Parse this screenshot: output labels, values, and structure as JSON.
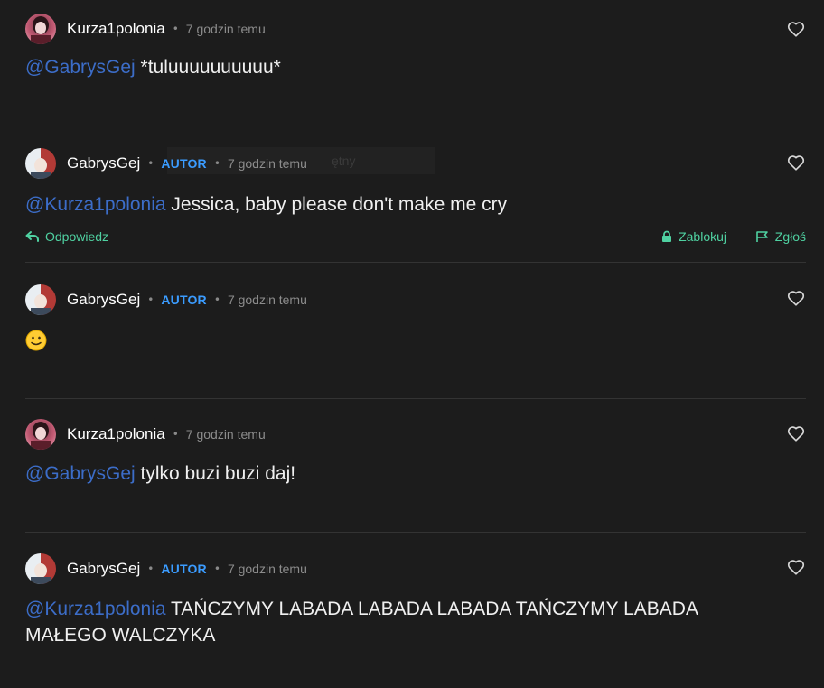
{
  "comments": [
    {
      "user": "Kurza1polonia",
      "badge": "",
      "time": "7 godzin temu",
      "mention": "@GabrysGej",
      "text": " *tuluuuuuuuuuu*"
    },
    {
      "user": "GabrysGej",
      "badge": "AUTOR",
      "time": "7 godzin temu",
      "mention": "@Kurza1polonia",
      "text": " Jessica, baby please don't make me cry"
    },
    {
      "user": "GabrysGej",
      "badge": "AUTOR",
      "time": "7 godzin temu",
      "mention": "",
      "text": ""
    },
    {
      "user": "Kurza1polonia",
      "badge": "",
      "time": "7 godzin temu",
      "mention": "@GabrysGej",
      "text": " tylko buzi buzi daj!"
    },
    {
      "user": "GabrysGej",
      "badge": "AUTOR",
      "time": "7 godzin temu",
      "mention": "@Kurza1polonia",
      "text": " TAŃCZYMY LABADA LABADA LABADA TAŃCZYMY LABADA MAŁEGO WALCZYKA"
    }
  ],
  "actions": {
    "reply": "Odpowiedz",
    "block": "Zablokuj",
    "report": "Zgłoś"
  },
  "ghost_text": "ętny",
  "icons": {
    "like": "heart-outline-icon",
    "reply": "reply-arrow-icon",
    "block": "lock-icon",
    "report": "flag-icon",
    "emoji": "slightly-smiling-face-emoji"
  },
  "colors": {
    "background": "#1c1c1c",
    "mention": "#3c6dc8",
    "badge": "#3b9cff",
    "action": "#4fd1a1"
  }
}
